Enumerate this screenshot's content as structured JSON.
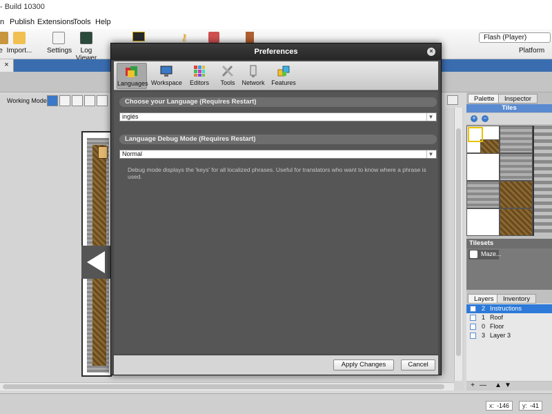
{
  "window": {
    "title": "- Build 10300"
  },
  "menu": {
    "items": [
      "n",
      "Publish",
      "Extensions",
      "Tools",
      "Help"
    ]
  },
  "toolbar": {
    "buttons": [
      {
        "label": "e",
        "icon": "save-icon"
      },
      {
        "label": "Import...",
        "icon": "import-icon"
      },
      {
        "label": "Settings",
        "icon": "settings-icon"
      },
      {
        "label": "Log Viewer",
        "icon": "log-viewer-icon"
      }
    ],
    "platform_value": "Flash (Player)",
    "platform_label": "Platform"
  },
  "doc_tab": {
    "close_glyph": "×"
  },
  "working_mode": {
    "label": "Working Mode"
  },
  "right_panel": {
    "tabs": [
      "Palette",
      "Inspector"
    ],
    "tiles_header": "Tiles",
    "tilesets_header": "Tilesets",
    "tileset_item": "Maze...",
    "layer_tabs": [
      "Layers",
      "Inventory"
    ],
    "layers": [
      {
        "num": "2",
        "name": "Instructions",
        "selected": true
      },
      {
        "num": "1",
        "name": "Roof",
        "selected": false
      },
      {
        "num": "0",
        "name": "Floor",
        "selected": false
      },
      {
        "num": "3",
        "name": "Layer 3",
        "selected": false
      }
    ],
    "layer_tool_glyphs": [
      "+",
      "—",
      "▲",
      "▼"
    ]
  },
  "status": {
    "x_label": "x:",
    "x_value": "-146",
    "y_label": "y:",
    "y_value": "-41"
  },
  "dialog": {
    "title": "Preferences",
    "close_glyph": "×",
    "tabs": [
      {
        "label": "Languages",
        "icon": "languages-icon",
        "active": true
      },
      {
        "label": "Workspace",
        "icon": "workspace-icon",
        "active": false
      },
      {
        "label": "Editors",
        "icon": "editors-icon",
        "active": false
      },
      {
        "label": "Tools",
        "icon": "tools-icon",
        "active": false
      },
      {
        "label": "Network",
        "icon": "network-icon",
        "active": false
      },
      {
        "label": "Features",
        "icon": "features-icon",
        "active": false
      }
    ],
    "language_section": "Choose your Language (Requires Restart)",
    "language_value": "inglés",
    "debug_section": "Language Debug Mode (Requires Restart)",
    "debug_value": "Normal",
    "debug_help": "Debug mode displays the 'keys' for all localized phrases. Useful for translators who want to know where a phrase is used.",
    "apply_label": "Apply Changes",
    "cancel_label": "Cancel"
  },
  "colors": {
    "accent": "#2d7ad8",
    "dialog_bg": "#565656",
    "title_bg": "#2e2e2e"
  }
}
